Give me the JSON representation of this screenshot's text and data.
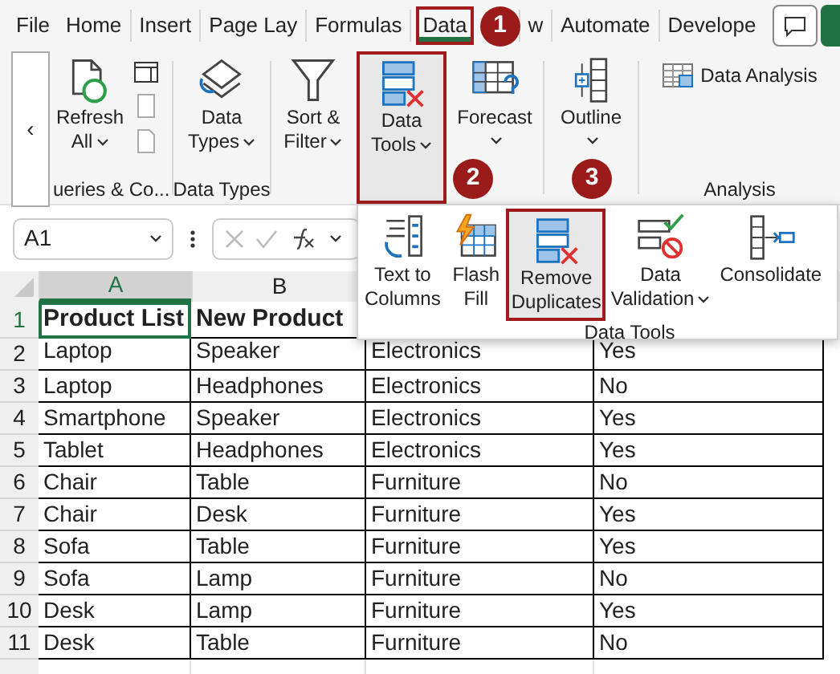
{
  "ribbon_tabs": [
    {
      "label": "File",
      "selected": false
    },
    {
      "label": "Home",
      "selected": false
    },
    {
      "label": "Insert",
      "selected": false
    },
    {
      "label": "Page Lay",
      "selected": false
    },
    {
      "label": "Formulas",
      "selected": false
    },
    {
      "label": "Data",
      "selected": true
    },
    {
      "label": "w",
      "selected": false
    },
    {
      "label": "Automate",
      "selected": false
    },
    {
      "label": "Develope",
      "selected": false
    }
  ],
  "scroll_button": "‹",
  "ribbon_groups": [
    {
      "label": "ueries & Co...",
      "buttons": [
        {
          "kind": "refresh",
          "lines": [
            "Refresh",
            "All"
          ],
          "dropdown": true,
          "highlighted": false
        }
      ]
    },
    {
      "label": "Data Types",
      "buttons": [
        {
          "kind": "data-types",
          "lines": [
            "Data",
            "Types"
          ],
          "dropdown": true,
          "highlighted": false
        }
      ]
    },
    {
      "buttons": [
        {
          "kind": "filter",
          "lines": [
            "Sort &",
            "Filter"
          ],
          "dropdown": true,
          "highlighted": false
        },
        {
          "kind": "data-tools",
          "lines": [
            "Data",
            "Tools"
          ],
          "dropdown": true,
          "highlighted": true
        },
        {
          "kind": "forecast",
          "lines": [
            "Forecast"
          ],
          "dropdown": true,
          "highlighted": false
        }
      ]
    },
    {
      "buttons": [
        {
          "kind": "outline",
          "lines": [
            "Outline"
          ],
          "dropdown": true,
          "highlighted": false
        }
      ]
    },
    {
      "label": "Analysis",
      "link": {
        "kind": "analysis",
        "label": "Data Analysis"
      }
    }
  ],
  "step_badges": [
    "1",
    "2",
    "3"
  ],
  "dropdown_panel": {
    "label": "Data Tools",
    "buttons": [
      {
        "kind": "text-to-columns",
        "lines": [
          "Text to",
          "Columns"
        ],
        "dropdown": false,
        "highlighted": false
      },
      {
        "kind": "flash-fill",
        "lines": [
          "Flash",
          "Fill"
        ],
        "dropdown": false,
        "highlighted": false
      },
      {
        "kind": "remove-duplicates",
        "lines": [
          "Remove",
          "Duplicates"
        ],
        "dropdown": false,
        "highlighted": true
      },
      {
        "kind": "data-validation",
        "lines": [
          "Data",
          "Validation"
        ],
        "dropdown": true,
        "highlighted": false
      },
      {
        "kind": "consolidate",
        "lines": [
          "Consolidate"
        ],
        "dropdown": false,
        "highlighted": false
      }
    ]
  },
  "name_box": "A1",
  "columns": [
    {
      "label": "A",
      "selected": true
    },
    {
      "label": "B",
      "selected": false
    }
  ],
  "rows": [
    {
      "number": "1",
      "header": true,
      "cells": [
        "Product List",
        "New Product"
      ]
    },
    {
      "number": "2",
      "header": false,
      "cells": [
        "Laptop",
        "Speaker",
        "Electronics",
        "Yes"
      ]
    },
    {
      "number": "3",
      "header": false,
      "cells": [
        "Laptop",
        "Headphones",
        "Electronics",
        "No"
      ]
    },
    {
      "number": "4",
      "header": false,
      "cells": [
        "Smartphone",
        "Speaker",
        "Electronics",
        "Yes"
      ]
    },
    {
      "number": "5",
      "header": false,
      "cells": [
        "Tablet",
        "Headphones",
        "Electronics",
        "Yes"
      ]
    },
    {
      "number": "6",
      "header": false,
      "cells": [
        "Chair",
        "Table",
        "Furniture",
        "No"
      ]
    },
    {
      "number": "7",
      "header": false,
      "cells": [
        "Chair",
        "Desk",
        "Furniture",
        "Yes"
      ]
    },
    {
      "number": "8",
      "header": false,
      "cells": [
        "Sofa",
        "Table",
        "Furniture",
        "Yes"
      ]
    },
    {
      "number": "9",
      "header": false,
      "cells": [
        "Sofa",
        "Lamp",
        "Furniture",
        "No"
      ]
    },
    {
      "number": "10",
      "header": false,
      "cells": [
        "Desk",
        "Lamp",
        "Furniture",
        "Yes"
      ]
    },
    {
      "number": "11",
      "header": false,
      "cells": [
        "Desk",
        "Table",
        "Furniture",
        "No"
      ]
    }
  ]
}
